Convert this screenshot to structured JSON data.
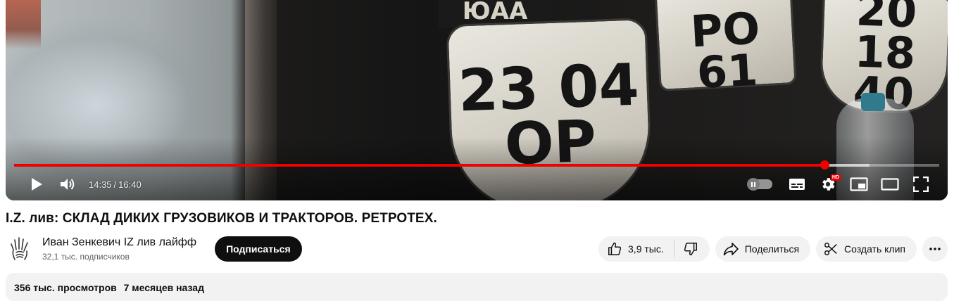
{
  "video": {
    "plates": {
      "top": "ЮАА",
      "main_line1": "23 04",
      "main_line2": "ОР",
      "right_line1": "РО 61",
      "far_right_line1": "20 18",
      "far_right_line2": "40"
    },
    "progress": {
      "played_fraction": 0.876,
      "buffered_fraction": 0.925
    },
    "time": {
      "current": "14:35",
      "separator": "/",
      "duration": "16:40"
    },
    "controls": {
      "play_icon": "play-icon",
      "volume_icon": "volume-icon",
      "autoplay_icon": "autoplay-toggle",
      "subtitles_icon": "subtitles-icon",
      "settings_icon": "gear-icon",
      "settings_badge": "HD",
      "miniplayer_icon": "miniplayer-icon",
      "theater_icon": "theater-mode-icon",
      "fullscreen_icon": "fullscreen-icon"
    },
    "colors": {
      "progress": "#f00000",
      "badge": "#f00000"
    }
  },
  "title": "I.Z. лив: СКЛАД ДИКИХ ГРУЗОВИКОВ И ТРАКТОРОВ. РЕТРОТЕХ.",
  "channel": {
    "name": "Иван Зенкевич IZ лив лайфф",
    "subscribers": "32,1 тыс. подписчиков",
    "subscribe_label": "Подписаться"
  },
  "actions": {
    "likes": "3,9 тыс.",
    "share_label": "Поделиться",
    "clip_label": "Создать клип"
  },
  "description": {
    "views": "356 тыс. просмотров",
    "date": "7 месяцев назад"
  }
}
